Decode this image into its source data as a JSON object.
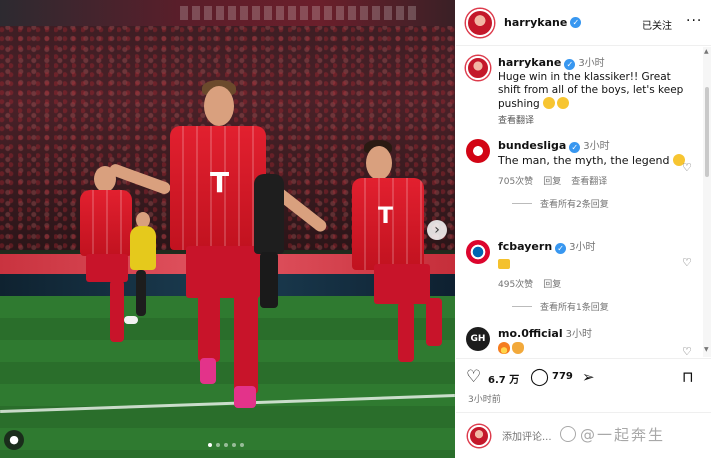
{
  "header": {
    "username": "harrykane",
    "follow_state": "已关注",
    "more": "···"
  },
  "caption": {
    "username": "harrykane",
    "time": "3小时",
    "text": "Huge win in the klassiker!! Great shift from all of the boys, let's keep pushing",
    "translate": "查看翻译"
  },
  "comments": [
    {
      "username": "bundesliga",
      "time": "3小时",
      "text": "The man, the myth, the legend",
      "likes": "705次赞",
      "reply": "回复",
      "translate": "查看翻译",
      "view_replies": "查看所有2条回复"
    },
    {
      "username": "fcbayern",
      "time": "3小时",
      "likes": "495次赞",
      "reply": "回复",
      "view_replies": "查看所有1条回复"
    },
    {
      "username": "mo.0fficial",
      "time": "3小时",
      "avatar_text": "GH"
    }
  ],
  "actions": {
    "likes": "6.7 万",
    "comments": "779"
  },
  "posted_time": "3小时前",
  "comment_input": {
    "placeholder": "添加评论..."
  },
  "watermark": "@一起奔生",
  "photo": {
    "shirt_logo": "T",
    "colors": {
      "kit_red": "#e2202f",
      "verified_blue": "#3897f0"
    }
  }
}
